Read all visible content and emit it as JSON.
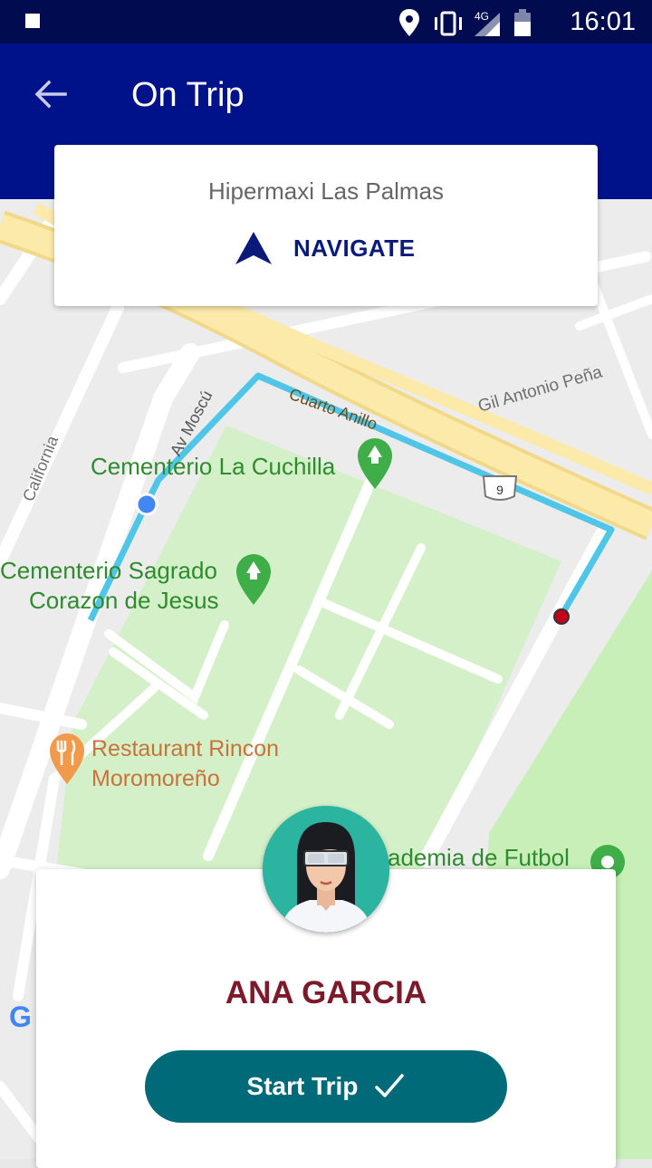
{
  "status_bar": {
    "time": "16:01",
    "network": "4G"
  },
  "app_bar": {
    "title": "On Trip"
  },
  "destination": {
    "name": "Hipermaxi Las Palmas",
    "navigate_label": "NAVIGATE"
  },
  "map": {
    "labels": {
      "street_california": "California",
      "street_av_moscu": "Av Moscú",
      "street_cuarto_anillo": "Cuarto Anillo",
      "street_gil_antonio_pena": "Gil Antonio Peña",
      "route_shield": "9",
      "poi_cementerio_cuchilla": "Cementerio La Cuchilla",
      "poi_cementerio_sagrado_1": "Cementerio Sagrado",
      "poi_cementerio_sagrado_2": "Corazon de Jesus",
      "poi_restaurant_1": "Restaurant Rincon",
      "poi_restaurant_2": "Moromoreño",
      "poi_academia": "ademia de Futbol",
      "google": "G"
    },
    "colors": {
      "route": "#4fc6e8",
      "park": "#cfeec2",
      "major_road": "#f9e7a4",
      "poi_green": "#2e8b2e",
      "poi_orange": "#d87f3a"
    }
  },
  "driver": {
    "name": "ANA GARCIA"
  },
  "actions": {
    "start_trip_label": "Start Trip"
  },
  "colors": {
    "app_bar": "#001289",
    "status_bar": "#000c4f",
    "accent_button": "#006a78",
    "driver_name": "#7d1a2a"
  },
  "icons": {
    "back": "arrow-left-icon",
    "navigate": "navigation-arrow-icon",
    "check": "check-icon",
    "park_pin": "park-pin-icon",
    "restaurant_pin": "restaurant-pin-icon"
  }
}
